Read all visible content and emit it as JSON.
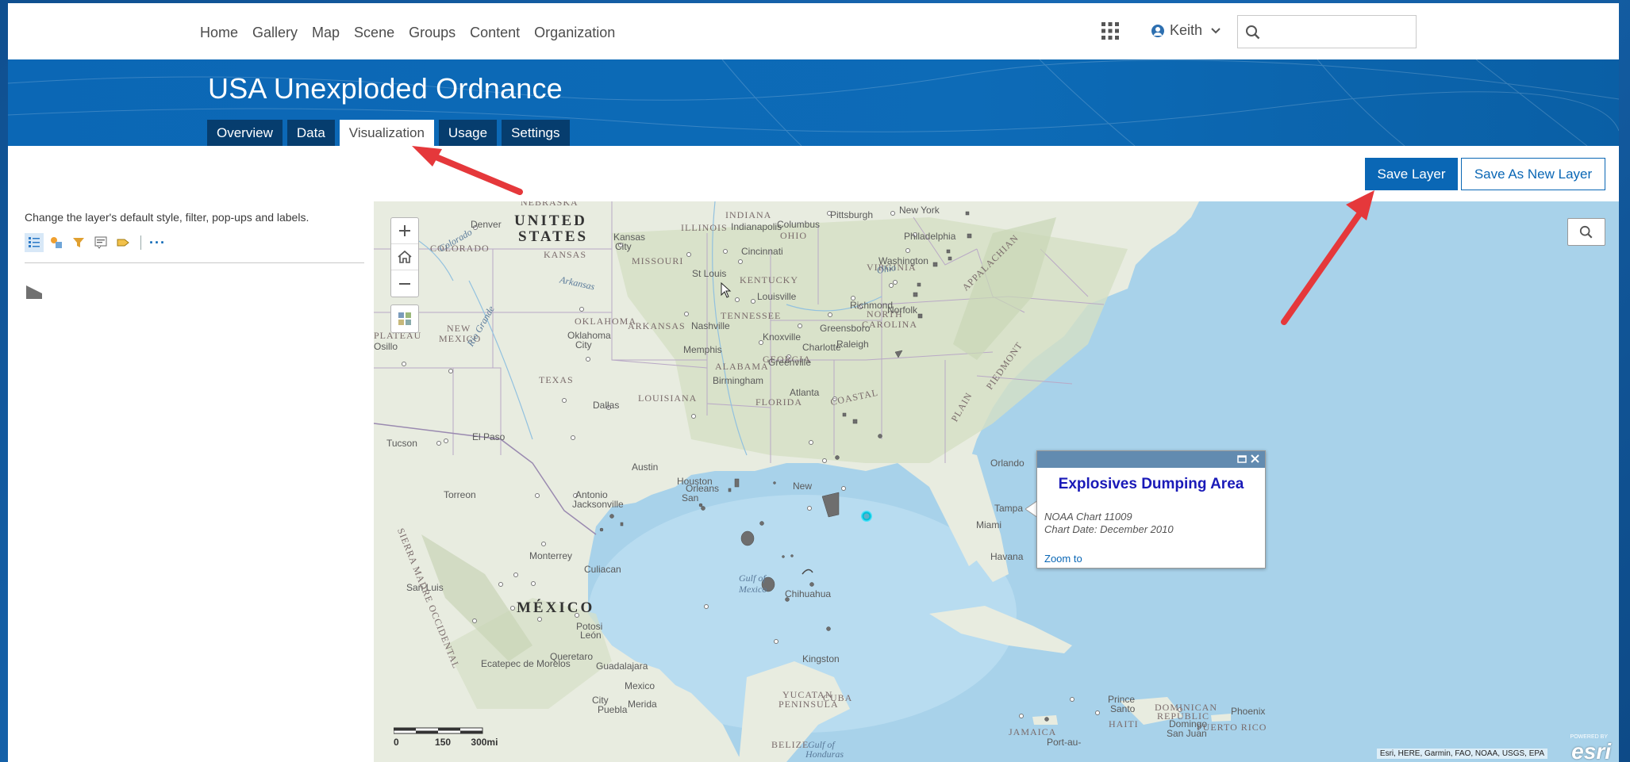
{
  "nav": {
    "links": [
      "Home",
      "Gallery",
      "Map",
      "Scene",
      "Groups",
      "Content",
      "Organization"
    ],
    "user": "Keith",
    "search_placeholder": ""
  },
  "header": {
    "title": "USA Unexploded Ordnance",
    "tabs": [
      "Overview",
      "Data",
      "Visualization",
      "Usage",
      "Settings"
    ],
    "active_tab": "Visualization"
  },
  "actions": {
    "save_layer": "Save Layer",
    "save_as_new": "Save As New Layer"
  },
  "panel": {
    "description": "Change the layer's default style, filter, pop-ups and labels.",
    "more": "···"
  },
  "map": {
    "labels": {
      "us": [
        "UNITED",
        "STATES"
      ],
      "mexico": "MÉXICO",
      "gulf": [
        "Gulf of",
        "Mexico"
      ],
      "gulf_honduras": [
        "Gulf of",
        "Honduras"
      ],
      "states": [
        "NEBRASKA",
        "KANSAS",
        "MISSOURI",
        "ILLINOIS",
        "INDIANA",
        "OHIO",
        "KENTUCKY",
        "TENNESSEE",
        "VIRGINIA",
        "NORTH",
        "CAROLINA",
        "ARKANSAS",
        "OKLAHOMA",
        "TEXAS",
        "LOUISIANA",
        "ALABAMA",
        "GEORGIA",
        "FLORIDA",
        "COLORADO",
        "NEW",
        "MEXICO",
        "CUBA",
        "JAMAICA",
        "HAITI",
        "DOMINICAN",
        "REPUBLIC",
        "PUERTO RICO",
        "BELIZE",
        "YUCATAN",
        "PENINSULA"
      ],
      "cities": [
        "Denver",
        "Kansas",
        "City",
        "Indianapolis",
        "Columbus",
        "Pittsburgh",
        "New York",
        "Philadelphia",
        "Washington",
        "Cincinnati",
        "St Louis",
        "Louisville",
        "Richmond",
        "Norfolk",
        "Nashville",
        "Knoxville",
        "Greensboro",
        "Raleigh",
        "Charlotte",
        "Greenville",
        "Memphis",
        "Oklahoma",
        "City",
        "Birmingham",
        "Atlanta",
        "Dallas",
        "El Paso",
        "Tucson",
        "Austin",
        "Houston",
        "New",
        "Orleans",
        "San",
        "Antonio",
        "Jacksonville",
        "Orlando",
        "Tampa",
        "Miami",
        "Havana",
        "Chihuahua",
        "Torreon",
        "Monterrey",
        "Culiacan",
        "San Luis",
        "Potosi",
        "León",
        "Queretaro",
        "Guadalajara",
        "Ecatepec de Morelos",
        "Mexico",
        "City",
        "Puebla",
        "Merida",
        "Kingston",
        "Port-au-",
        "Prince",
        "Santo",
        "Domingo",
        "San Juan",
        "Phoenix",
        "Osillo"
      ],
      "terrain": [
        "APPALACHIAN",
        "COASTAL",
        "PLAIN",
        "PIEDMONT",
        "SIERRA MADRE OCCIDENTAL",
        "PLATEAU",
        "Rio Grande",
        "Colorado",
        "Arkansas",
        "Ohio"
      ]
    },
    "scale": [
      "0",
      "150",
      "300mi"
    ],
    "attribution": "Esri, HERE, Garmin, FAO, NOAA, USGS, EPA",
    "esri_logo": "esri",
    "powered_by": "POWERED BY"
  },
  "popup": {
    "title": "Explosives Dumping Area",
    "line1": "NOAA Chart 11009",
    "line2": "Chart Date: December 2010",
    "zoom_to": "Zoom to"
  },
  "colors": {
    "brand_blue": "#0a67b5",
    "tab_dark": "#063d6e",
    "popup_header": "#628bb0",
    "popup_title": "#1a1ab8",
    "annotation_arrow": "#e5383b",
    "symbol_gray": "#6e6e6e",
    "highlight_cyan": "#00e5ff"
  }
}
